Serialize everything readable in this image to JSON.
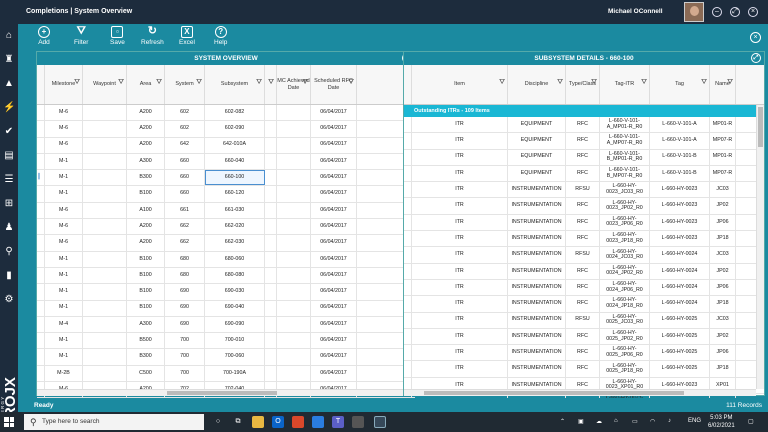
{
  "window": {
    "title": "Completions | System Overview",
    "user": "Michael OConnell"
  },
  "toolbar": {
    "add": "Add",
    "filter": "Filter",
    "save": "Save",
    "refresh": "Refresh",
    "excel": "Excel",
    "help": "Help"
  },
  "left": {
    "title": "SYSTEM OVERVIEW",
    "headers": [
      "Milestone",
      "Waypoint",
      "Area",
      "System",
      "Subsystem",
      "",
      "MC Achieved Date",
      "Scheduled RFC Date"
    ],
    "rows": [
      [
        "M-6",
        "",
        "A200",
        "602",
        "602-082",
        "",
        "",
        "06/04/2017"
      ],
      [
        "M-6",
        "",
        "A200",
        "602",
        "602-090",
        "",
        "",
        "06/04/2017"
      ],
      [
        "M-6",
        "",
        "A200",
        "642",
        "642-010A",
        "",
        "",
        "06/04/2017"
      ],
      [
        "M-1",
        "",
        "A300",
        "660",
        "660-040",
        "",
        "",
        "06/04/2017"
      ],
      [
        "M-1",
        "",
        "B300",
        "660",
        "660-100",
        "",
        "",
        "06/04/2017"
      ],
      [
        "M-1",
        "",
        "B100",
        "660",
        "660-120",
        "",
        "",
        "06/04/2017"
      ],
      [
        "M-6",
        "",
        "A100",
        "661",
        "661-030",
        "",
        "",
        "06/04/2017"
      ],
      [
        "M-6",
        "",
        "A200",
        "662",
        "662-020",
        "",
        "",
        "06/04/2017"
      ],
      [
        "M-6",
        "",
        "A200",
        "662",
        "662-030",
        "",
        "",
        "06/04/2017"
      ],
      [
        "M-1",
        "",
        "B100",
        "680",
        "680-060",
        "",
        "",
        "06/04/2017"
      ],
      [
        "M-1",
        "",
        "B100",
        "680",
        "680-080",
        "",
        "",
        "06/04/2017"
      ],
      [
        "M-1",
        "",
        "B100",
        "690",
        "690-030",
        "",
        "",
        "06/04/2017"
      ],
      [
        "M-1",
        "",
        "B100",
        "690",
        "690-040",
        "",
        "",
        "06/04/2017"
      ],
      [
        "M-4",
        "",
        "A300",
        "690",
        "690-090",
        "",
        "",
        "06/04/2017"
      ],
      [
        "M-1",
        "",
        "B500",
        "700",
        "700-010",
        "",
        "",
        "06/04/2017"
      ],
      [
        "M-1",
        "",
        "B300",
        "700",
        "700-060",
        "",
        "",
        "06/04/2017"
      ],
      [
        "M-2B",
        "",
        "C500",
        "700",
        "700-190A",
        "",
        "",
        "06/04/2017"
      ],
      [
        "M-6",
        "",
        "A200",
        "702",
        "702-040",
        "",
        "",
        "06/04/2017"
      ],
      [
        "M-1",
        "",
        "E300",
        "710",
        "710-010",
        "",
        "",
        "06/04/2017"
      ],
      [
        "M-1",
        "",
        "E300",
        "710",
        "710-100",
        "",
        "",
        "06/04/2017"
      ]
    ]
  },
  "right": {
    "title": "SUBSYSTEM DETAILS - 660-100",
    "headers": [
      "Item",
      "Discipline",
      "Type/Class",
      "Tag-ITR",
      "Tag",
      "Name"
    ],
    "outstanding": "Outstanding ITRs - 109 Items",
    "rows": [
      [
        "ITR",
        "EQUIPMENT",
        "RFC",
        "L-660-V-101-A_MP01-R_R0",
        "L-660-V-101-A",
        "MP01-R"
      ],
      [
        "ITR",
        "EQUIPMENT",
        "RFC",
        "L-660-V-101-A_MP07-R_R0",
        "L-660-V-101-A",
        "MP07-R"
      ],
      [
        "ITR",
        "EQUIPMENT",
        "RFC",
        "L-660-V-101-B_MP01-R_R0",
        "L-660-V-101-B",
        "MP01-R"
      ],
      [
        "ITR",
        "EQUIPMENT",
        "RFC",
        "L-660-V-101-B_MP07-R_R0",
        "L-660-V-101-B",
        "MP07-R"
      ],
      [
        "ITR",
        "INSTRUMENTATION",
        "RFSU",
        "L-660-HY-0023_JC03_R0",
        "L-660-HY-0023",
        "JC03"
      ],
      [
        "ITR",
        "INSTRUMENTATION",
        "RFC",
        "L-660-HY-0023_JP02_R0",
        "L-660-HY-0023",
        "JP02"
      ],
      [
        "ITR",
        "INSTRUMENTATION",
        "RFC",
        "L-660-HY-0023_JP06_R0",
        "L-660-HY-0023",
        "JP06"
      ],
      [
        "ITR",
        "INSTRUMENTATION",
        "RFC",
        "L-660-HY-0023_JP18_R0",
        "L-660-HY-0023",
        "JP18"
      ],
      [
        "ITR",
        "INSTRUMENTATION",
        "RFSU",
        "L-660-HY-0024_JC03_R0",
        "L-660-HY-0024",
        "JC03"
      ],
      [
        "ITR",
        "INSTRUMENTATION",
        "RFC",
        "L-660-HY-0024_JP02_R0",
        "L-660-HY-0024",
        "JP02"
      ],
      [
        "ITR",
        "INSTRUMENTATION",
        "RFC",
        "L-660-HY-0024_JP06_R0",
        "L-660-HY-0024",
        "JP06"
      ],
      [
        "ITR",
        "INSTRUMENTATION",
        "RFC",
        "L-660-HY-0024_JP18_R0",
        "L-660-HY-0024",
        "JP18"
      ],
      [
        "ITR",
        "INSTRUMENTATION",
        "RFSU",
        "L-660-HY-0025_JC03_R0",
        "L-660-HY-0025",
        "JC03"
      ],
      [
        "ITR",
        "INSTRUMENTATION",
        "RFC",
        "L-660-HY-0025_JP02_R0",
        "L-660-HY-0025",
        "JP02"
      ],
      [
        "ITR",
        "INSTRUMENTATION",
        "RFC",
        "L-660-HY-0025_JP06_R0",
        "L-660-HY-0025",
        "JP06"
      ],
      [
        "ITR",
        "INSTRUMENTATION",
        "RFC",
        "L-660-HY-0025_JP18_R0",
        "L-660-HY-0025",
        "JP18"
      ],
      [
        "ITR",
        "INSTRUMENTATION",
        "RFC",
        "L-660-HY-0023_XP01_R0",
        "L-660-HY-0023",
        "XP01"
      ],
      [
        "ITR",
        "INSTRUMENTATION",
        "RFC",
        "L-660-HY-0023-J1_JP11_R0",
        "L-660-HY-0023-J1",
        "JP11"
      ],
      [
        "ITR",
        "INSTRUMENTATION",
        "RFC",
        "L-660-HY-0024_XP01_R0",
        "L-660-HY-0024",
        "XP01"
      ]
    ]
  },
  "status": {
    "ready": "Ready",
    "records": "111 Records"
  },
  "taskbar": {
    "search_placeholder": "Type here to search",
    "lang": "ENG",
    "time": "5:03 PM",
    "date": "6/02/2021"
  },
  "colors": {
    "accent": "#1b8aa0",
    "dark": "#1d2c3d",
    "outstanding": "#1ab7d4"
  }
}
